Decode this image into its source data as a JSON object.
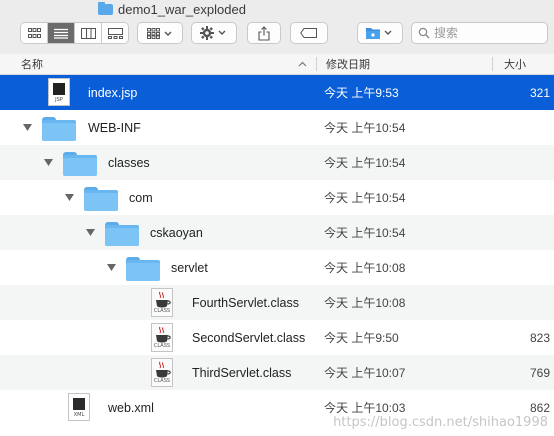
{
  "window": {
    "title": "demo1_war_exploded"
  },
  "toolbar": {
    "view_modes": [
      "icon-view",
      "list-view",
      "column-view",
      "gallery-view"
    ],
    "active_view": "list-view",
    "group_icon": "grid-icon",
    "action_icon": "gear-icon",
    "share_icon": "share-icon",
    "tag_icon": "tag-icon",
    "location_icon": "folder-icon"
  },
  "search": {
    "placeholder": "搜索"
  },
  "columns": {
    "name": "名称",
    "modified": "修改日期",
    "size": "大小"
  },
  "files": [
    {
      "name": "index.jsp",
      "date": "今天 上午9:53",
      "size": "321",
      "kind": "jsp",
      "selected": true
    },
    {
      "name": "WEB-INF",
      "date": "今天 上午10:54",
      "size": "",
      "kind": "folder"
    },
    {
      "name": "classes",
      "date": "今天 上午10:54",
      "size": "",
      "kind": "folder"
    },
    {
      "name": "com",
      "date": "今天 上午10:54",
      "size": "",
      "kind": "folder"
    },
    {
      "name": "cskaoyan",
      "date": "今天 上午10:54",
      "size": "",
      "kind": "folder"
    },
    {
      "name": "servlet",
      "date": "今天 上午10:08",
      "size": "",
      "kind": "folder"
    },
    {
      "name": "FourthServlet.class",
      "date": "今天 上午10:08",
      "size": "",
      "kind": "class"
    },
    {
      "name": "SecondServlet.class",
      "date": "今天 上午9:50",
      "size": "823",
      "kind": "class"
    },
    {
      "name": "ThirdServlet.class",
      "date": "今天 上午10:07",
      "size": "769",
      "kind": "class"
    },
    {
      "name": "web.xml",
      "date": "今天 上午10:03",
      "size": "862",
      "kind": "xml"
    }
  ],
  "icon_labels": {
    "jsp": "JSP",
    "class": "CLASS",
    "xml": "XML"
  },
  "watermark": "https://blog.csdn.net/shihao1998"
}
